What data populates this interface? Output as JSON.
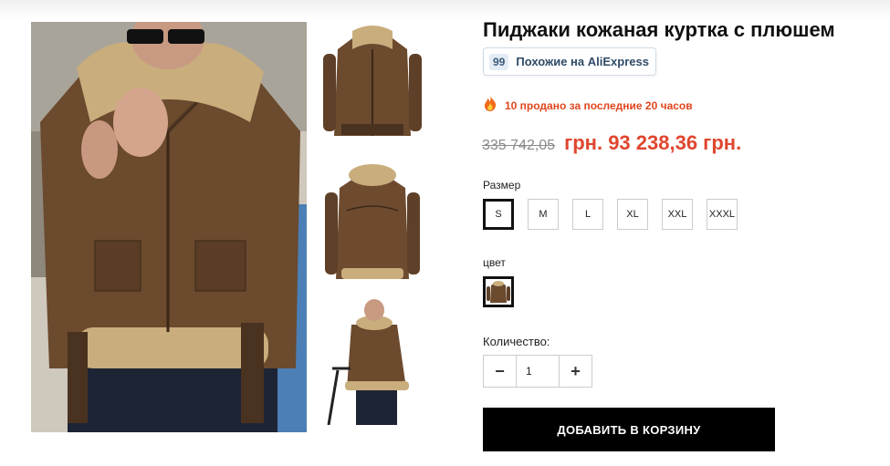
{
  "product": {
    "title": "Пиджаки кожаная куртка с плюшем",
    "ali_badge": {
      "count": "99",
      "text": "Похожие на AliExpress"
    },
    "sold_text": "10 продано за последние 20 часов",
    "old_price": "335 742,05",
    "new_price": "грн. 93 238,36 грн."
  },
  "options": {
    "size_label": "Размер",
    "sizes": [
      "S",
      "M",
      "L",
      "XL",
      "XXL",
      "XXXL"
    ],
    "selected_size": "S",
    "color_label": "цвет"
  },
  "quantity": {
    "label": "Количество:",
    "value": "1",
    "minus": "−",
    "plus": "+"
  },
  "cart": {
    "button_label": "ДОБАВИТЬ В КОРЗИНУ"
  },
  "colors": {
    "price_red": "#e0462f",
    "fire_orange": "#e0461e",
    "button_black": "#000000",
    "leather_brown": "#6b4a2e",
    "shearling": "#c9ad7c"
  }
}
